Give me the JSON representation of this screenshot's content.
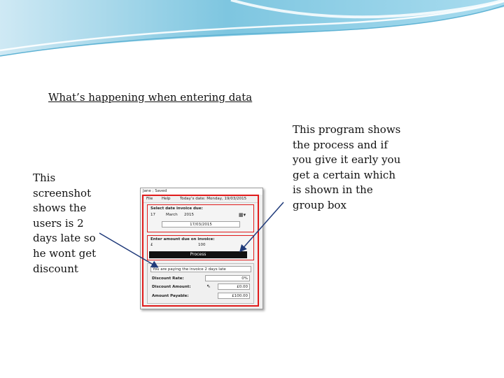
{
  "slide": {
    "title": "What’s happening when entering data",
    "left_note": "This screenshot shows the users is 2 days late so he wont get discount",
    "right_note": "This program shows the process and if you give it early you get a certain which is shown in the group box"
  },
  "screenshot": {
    "window_title": "Jane ; Saved",
    "menu": {
      "file": "File",
      "help": "Help",
      "today": "Today’s date: Monday, 19/03/2015"
    },
    "date_group": {
      "label": "Select date invoice due:",
      "day": "17",
      "month": "March",
      "year": "2015",
      "selected_date": "17/03/2015"
    },
    "amount_group": {
      "label": "Enter amount due on invoice:",
      "currency": "£",
      "amount": "100"
    },
    "process_label": "Process",
    "result_group": {
      "message": "You are paying the invoice 2 days late",
      "discount_rate_label": "Discount Rate:",
      "discount_rate_value": "0%",
      "discount_amount_label": "Discount Amount:",
      "discount_amount_value": "£0.00",
      "amount_payable_label": "Amount Payable:",
      "amount_payable_value": "£100.00"
    }
  },
  "colors": {
    "frame_red": "#e01b1b",
    "arrow_navy": "#1f3a7a",
    "wave_blue": "#7ec6e0"
  }
}
